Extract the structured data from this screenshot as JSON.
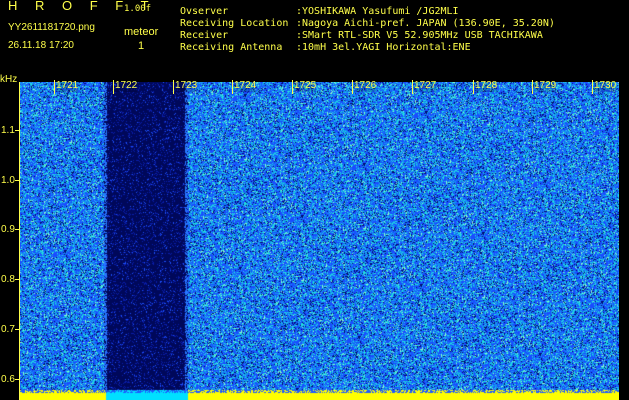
{
  "header": {
    "app_name": "H R O F F T",
    "version": "1.00f",
    "filename": "YY2611181720.png",
    "meteor_label": "meteor",
    "datetime": "26.11.18 17:20",
    "meteor_count": "1"
  },
  "info": {
    "observer_key": "Ovserver",
    "observer_val": ":YOSHIKAWA Yasufumi /JG2MLI",
    "location_key": "Receiving Location",
    "location_val": ":Nagoya Aichi-pref. JAPAN (136.90E, 35.20N)",
    "receiver_key": "Receiver",
    "receiver_val": ":SMart RTL-SDR V5 52.905MHz USB TACHIKAWA",
    "antenna_key": "Receiving Antenna",
    "antenna_val": ":10mH 3el.YAGI Horizontal:ENE"
  },
  "time_axis": {
    "labels": [
      "1721",
      "1722",
      "1723",
      "1724",
      "1725",
      "1726",
      "1727",
      "1728",
      "1729",
      "1730"
    ]
  },
  "freq_axis": {
    "unit": "kHz",
    "labels": [
      "1.1",
      "1.0",
      "0.9",
      "0.8",
      "0.7",
      "0.6"
    ]
  },
  "colors": {
    "text": "#ffff4a",
    "background": "#000000",
    "noise_low": "#000a6e",
    "noise_mid": "#1a4cff",
    "noise_high": "#22e0e0",
    "band_bottom": "#ffff00",
    "gap_bottom": "#00e0ff"
  }
}
